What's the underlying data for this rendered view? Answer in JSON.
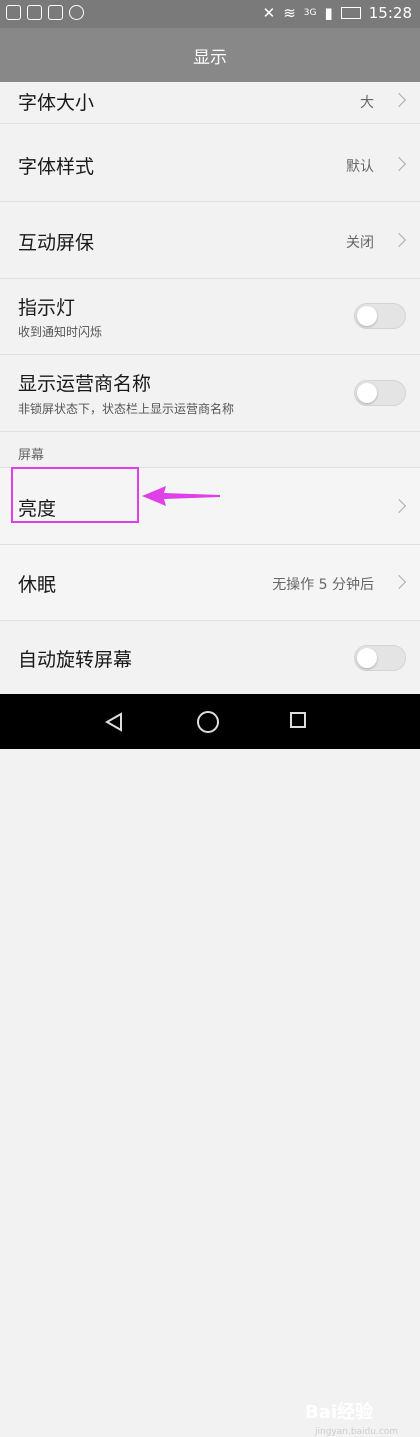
{
  "status_bar": {
    "time": "15:28",
    "network": "3G"
  },
  "header": {
    "title": "显示"
  },
  "rows": [
    {
      "title": "字体大小",
      "value": "大"
    },
    {
      "title": "字体样式",
      "value": "默认"
    },
    {
      "title": "互动屏保",
      "value": "关闭"
    },
    {
      "title": "指示灯",
      "subtitle": "收到通知时闪烁",
      "toggle": "off"
    },
    {
      "title": "显示运营商名称",
      "subtitle": "非锁屏状态下，状态栏上显示运营商名称",
      "toggle": "off"
    },
    {
      "title": "亮度"
    },
    {
      "title": "休眠",
      "value": "无操作 5 分钟后"
    },
    {
      "title": "自动旋转屏幕",
      "toggle": "off"
    }
  ],
  "section": {
    "label": "屏幕"
  },
  "watermark": {
    "brand": "Bai经验",
    "url": "jingyan.baidu.com"
  },
  "colors": {
    "highlight": "#e040e8",
    "header": "#888888"
  }
}
